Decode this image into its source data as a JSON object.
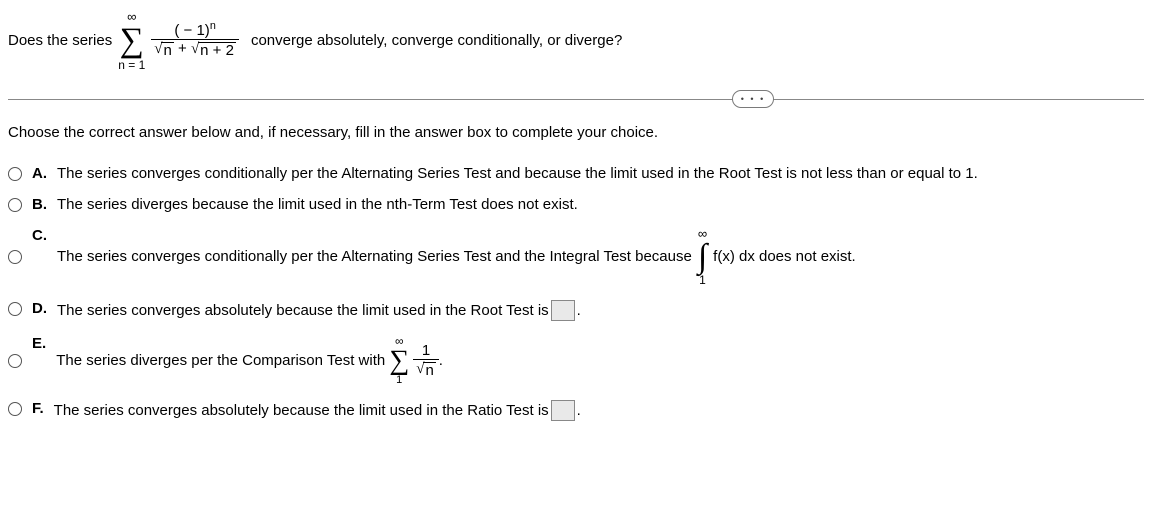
{
  "stem": {
    "before": "Does the series",
    "after": "converge absolutely, converge conditionally, or diverge?",
    "sum_upper": "∞",
    "sum_lower": "n = 1",
    "numerator_base": "( − 1)",
    "numerator_exp": "n",
    "den_sqrt1": "n",
    "den_plus": " + ",
    "den_sqrt2": "n + 2"
  },
  "pill": "• • •",
  "instruction": "Choose the correct answer below and, if necessary, fill in the answer box to complete your choice.",
  "choices": {
    "A": "The series converges conditionally per the Alternating Series Test and because the limit used in the Root Test is not less than or equal to 1.",
    "B": "The series diverges because the limit used in the nth-Term Test does not exist.",
    "C_before": "The series converges conditionally per the Alternating Series Test and the Integral Test because",
    "C_int_upper": "∞",
    "C_int_lower": "1",
    "C_after": "f(x) dx does not exist.",
    "D_before": "The series converges absolutely because the limit used in the Root Test is",
    "D_after": ".",
    "E_before": "The series diverges per the Comparison Test with",
    "E_sum_upper": "∞",
    "E_sum_lower": "1",
    "E_frac_num": "1",
    "E_frac_den": "n",
    "E_after": ".",
    "F_before": "The series converges absolutely because the limit used in the Ratio Test is",
    "F_after": "."
  },
  "labels": {
    "A": "A.",
    "B": "B.",
    "C": "C.",
    "D": "D.",
    "E": "E.",
    "F": "F."
  }
}
